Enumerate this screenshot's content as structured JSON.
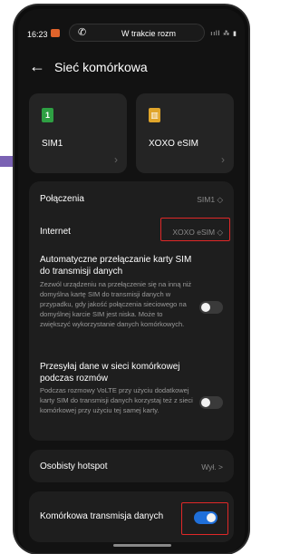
{
  "status_bar": {
    "time": "16:23",
    "call_text": "W trakcie rozm",
    "signal": "ııll ⁂ ▮"
  },
  "header": {
    "back_icon": "arrow-left-icon",
    "title": "Sieć komórkowa"
  },
  "sims": [
    {
      "badge": "1",
      "name": "SIM1",
      "color": "#2ea043"
    },
    {
      "badge": "▥",
      "name": "XOXO eSIM",
      "color": "#e0a52b"
    }
  ],
  "settings": {
    "calls": {
      "label": "Połączenia",
      "value": "SIM1 ◇"
    },
    "internet": {
      "label": "Internet",
      "value": "XOXO eSIM ◇"
    },
    "auto_switch": {
      "title": "Automatyczne przełączanie karty SIM do transmisji danych",
      "desc": "Zezwól urządzeniu na przełączenie się na inną niż domyślna kartę SIM do transmisji danych w przypadku, gdy jakość połączenia sieciowego na domyślnej karcie SIM jest niska. Może to zwiększyć wykorzystanie danych komórkowych.",
      "enabled": false
    },
    "data_during_calls": {
      "title": "Przesyłaj dane w sieci komórkowej podczas rozmów",
      "desc": "Podczas rozmowy VoLTE przy użyciu dodatkowej karty SIM do transmisji danych korzystaj też z sieci komórkowej przy użyciu tej samej karty.",
      "enabled": false
    }
  },
  "hotspot": {
    "label": "Osobisty hotspot",
    "value": "Wył. >"
  },
  "mobile_data": {
    "label": "Komórkowa transmisja danych",
    "enabled": true
  },
  "highlight_color": "#e02828",
  "accent_color": "#1f6fd9"
}
